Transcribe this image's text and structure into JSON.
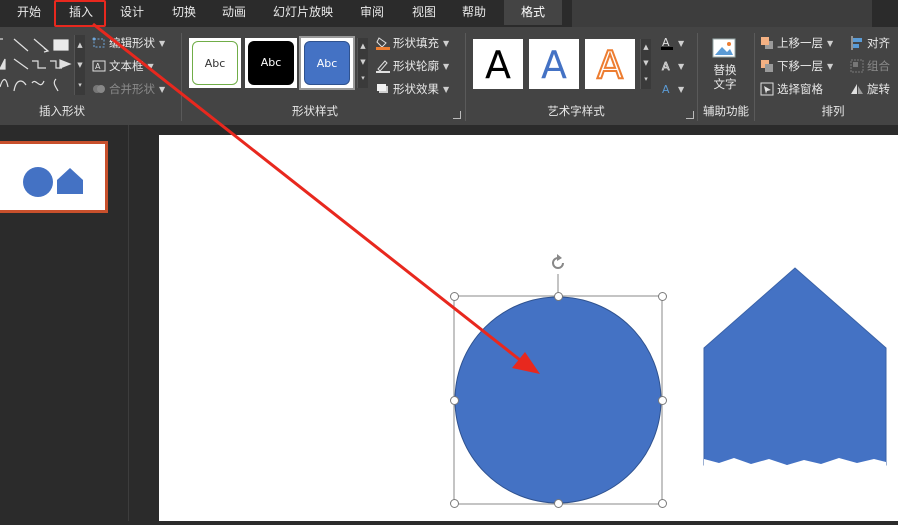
{
  "tabs": [
    {
      "label": "开始"
    },
    {
      "label": "插入"
    },
    {
      "label": "设计"
    },
    {
      "label": "切换"
    },
    {
      "label": "动画"
    },
    {
      "label": "幻灯片放映"
    },
    {
      "label": "审阅"
    },
    {
      "label": "视图"
    },
    {
      "label": "帮助"
    },
    {
      "label": "格式"
    }
  ],
  "ribbon": {
    "insert_shapes": {
      "label": "插入形状",
      "edit_shape": "编辑形状",
      "text_box": "文本框",
      "merge_shapes": "合并形状"
    },
    "shape_styles": {
      "label": "形状样式",
      "swatches": [
        "Abc",
        "Abc",
        "Abc"
      ],
      "fill": "形状填充",
      "outline": "形状轮廓",
      "effects": "形状效果"
    },
    "wordart_styles": {
      "label": "艺术字样式",
      "letters": [
        "A",
        "A",
        "A"
      ]
    },
    "accessibility": {
      "label": "辅助功能",
      "alt_text": "替换文字"
    },
    "arrange": {
      "label": "排列",
      "bring_forward": "上移一层",
      "send_backward": "下移一层",
      "selection_pane": "选择窗格",
      "align": "对齐",
      "group": "组合",
      "rotate": "旋转"
    }
  },
  "colors": {
    "shape_blue": "#4472c4",
    "annotation_red": "#e8281e",
    "thumbnail_border": "#c8502c",
    "ribbon_bg": "#444444",
    "app_bg": "#2b2b2b"
  }
}
